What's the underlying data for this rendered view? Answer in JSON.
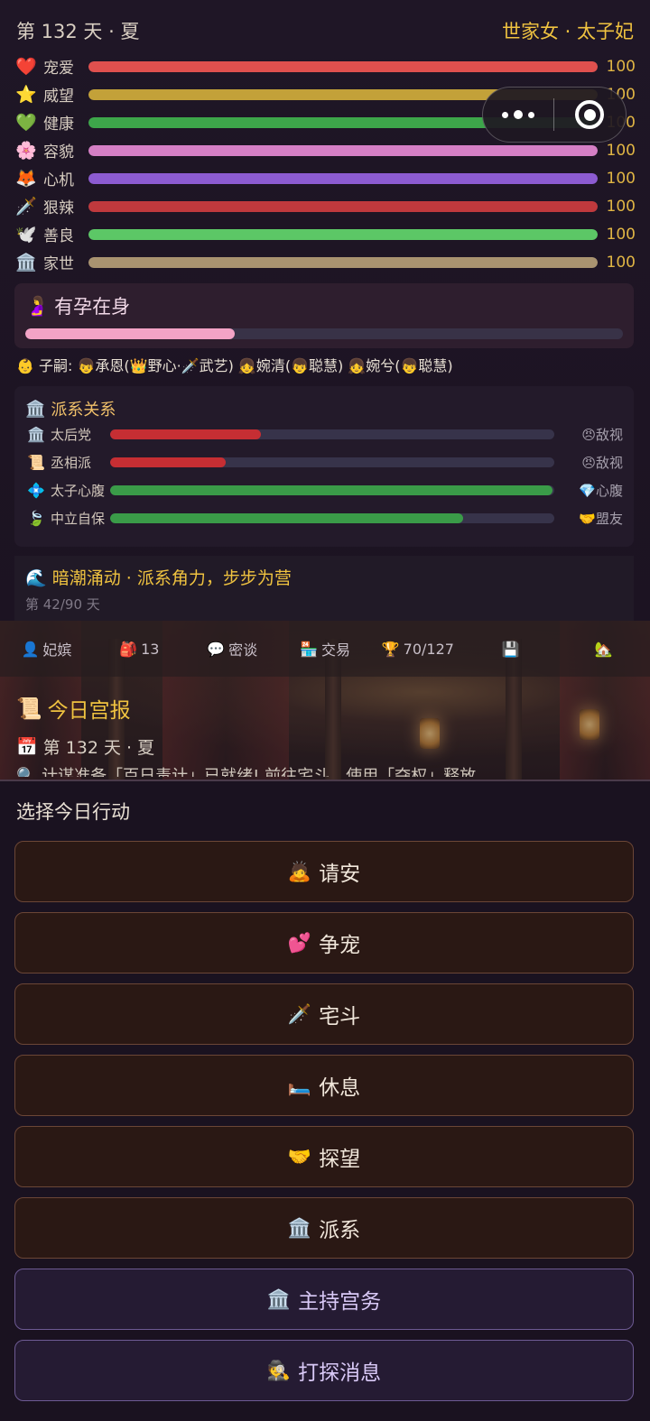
{
  "header": {
    "day": "第 132 天 · 夏",
    "rank": "世家女 · 太子妃"
  },
  "stats": [
    {
      "icon": "❤️",
      "name": "宠爱",
      "value": "100",
      "level": 1.0,
      "color": "#e0504e"
    },
    {
      "icon": "⭐",
      "name": "威望",
      "value": "100",
      "level": 1.0,
      "color": "#c3a139"
    },
    {
      "icon": "💚",
      "name": "健康",
      "value": "100",
      "level": 1.0,
      "color": "#3da64a"
    },
    {
      "icon": "🌸",
      "name": "容貌",
      "value": "100",
      "level": 1.0,
      "color": "#d57fc5"
    },
    {
      "icon": "🦊",
      "name": "心机",
      "value": "100",
      "level": 1.0,
      "color": "#8c5bd1"
    },
    {
      "icon": "🗡️",
      "name": "狠辣",
      "value": "100",
      "level": 1.0,
      "color": "#c0393d"
    },
    {
      "icon": "🕊️",
      "name": "善良",
      "value": "100",
      "level": 1.0,
      "color": "#5cc766"
    },
    {
      "icon": "🏛️",
      "name": "家世",
      "value": "100",
      "level": 1.0,
      "color": "#a99370"
    }
  ],
  "pregnancy": {
    "icon": "🤰",
    "title": "有孕在身",
    "progress": 0.35,
    "color": "#f3a3c6"
  },
  "children_text": "👶 子嗣: 👦承恩(👑野心·🗡️武艺) 👧婉清(👦聪慧) 👧婉兮(👦聪慧)",
  "factions": {
    "icon": "🏛️",
    "title": "派系关系",
    "rows": [
      {
        "icon": "🏛️",
        "name": "太后党",
        "level": 0.34,
        "color": "#c62e33",
        "relation": "😠敌视"
      },
      {
        "icon": "📜",
        "name": "丞相派",
        "level": 0.26,
        "color": "#c62e33",
        "relation": "😠敌视"
      },
      {
        "icon": "💠",
        "name": "太子心腹",
        "level": 0.995,
        "color": "#3a9b48",
        "relation": "💎心腹"
      },
      {
        "icon": "🍃",
        "name": "中立自保",
        "level": 0.795,
        "color": "#3a9b48",
        "relation": "🤝盟友"
      }
    ]
  },
  "event": {
    "title": "🌊 暗潮涌动 · 派系角力，步步为营",
    "progress": "第 42/90 天"
  },
  "toolbar": [
    {
      "icon": "👤",
      "label": "妃嫔",
      "name": "toolbar-concubines",
      "iconName": "person-icon"
    },
    {
      "icon": "🎒",
      "label": "13",
      "name": "toolbar-bag",
      "iconName": "backpack-icon"
    },
    {
      "icon": "💬",
      "label": "密谈",
      "name": "toolbar-secret-talk",
      "iconName": "speech-bubble-icon"
    },
    {
      "icon": "🏪",
      "label": "交易",
      "name": "toolbar-trade",
      "iconName": "shop-icon"
    },
    {
      "icon": "🏆",
      "label": "70/127",
      "name": "toolbar-achievements",
      "iconName": "trophy-icon"
    },
    {
      "icon": "💾",
      "label": "",
      "name": "toolbar-save",
      "iconName": "floppy-disk-icon"
    },
    {
      "icon": "🏡",
      "label": "",
      "name": "toolbar-home",
      "iconName": "house-icon"
    }
  ],
  "news": {
    "icon": "📜",
    "title": "今日宫报",
    "date_icon": "📅",
    "date": "第 132 天 · 夏",
    "line": "🔍 计谋准备「百日毒计」已就绪! 前往宅斗，使用「夺权」释放"
  },
  "actions": {
    "title": "选择今日行动",
    "buttons": [
      {
        "icon": "🙇",
        "label": "请安",
        "style": "brown",
        "name": "action-greet-button",
        "iconName": "bowing-person-icon"
      },
      {
        "icon": "💕",
        "label": "争宠",
        "style": "brown",
        "name": "action-compete-favor-button",
        "iconName": "two-hearts-icon"
      },
      {
        "icon": "🗡️",
        "label": "宅斗",
        "style": "brown",
        "name": "action-intrigue-button",
        "iconName": "dagger-icon"
      },
      {
        "icon": "🛏️",
        "label": "休息",
        "style": "brown",
        "name": "action-rest-button",
        "iconName": "bed-icon"
      },
      {
        "icon": "🤝",
        "label": "探望",
        "style": "brown",
        "name": "action-visit-button",
        "iconName": "handshake-icon"
      },
      {
        "icon": "🏛️",
        "label": "派系",
        "style": "brown",
        "name": "action-faction-button",
        "iconName": "classical-building-icon"
      },
      {
        "icon": "🏛️",
        "label": "主持宫务",
        "style": "purple",
        "name": "action-manage-palace-button",
        "iconName": "classical-building-icon"
      },
      {
        "icon": "🕵️",
        "label": "打探消息",
        "style": "purple",
        "name": "action-gather-intel-button",
        "iconName": "detective-icon"
      }
    ]
  }
}
